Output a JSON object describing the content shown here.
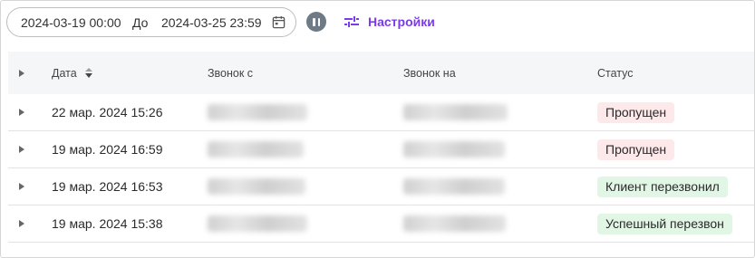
{
  "toolbar": {
    "date_from": "2024-03-19 00:00",
    "separator": "До",
    "date_to": "2024-03-25 23:59",
    "settings_label": "Настройки",
    "accent_color": "#7c3aed"
  },
  "table": {
    "headers": {
      "date": "Дата",
      "call_from": "Звонок с",
      "call_to": "Звонок на",
      "status": "Статус"
    },
    "rows": [
      {
        "date": "22 мар. 2024 15:26",
        "status": "Пропущен",
        "status_type": "missed"
      },
      {
        "date": "19 мар. 2024 16:59",
        "status": "Пропущен",
        "status_type": "missed"
      },
      {
        "date": "19 мар. 2024 16:53",
        "status": "Клиент перезвонил",
        "status_type": "called"
      },
      {
        "date": "19 мар. 2024 15:38",
        "status": "Успешный перезвон",
        "status_type": "called"
      }
    ]
  },
  "colors": {
    "missed_badge": "#fde8ea",
    "success_badge": "#e2f6e6",
    "header_bg": "#f5f6f8"
  }
}
